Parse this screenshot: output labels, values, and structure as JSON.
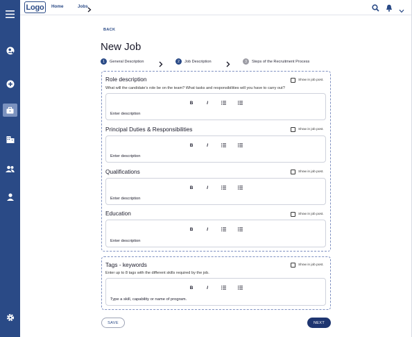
{
  "colors": {
    "brand": "#2a4a86",
    "brand_dark": "#1e3570",
    "dash_border": "#7d8fc0",
    "step_inactive": "#9c9ca4"
  },
  "topbar": {
    "logo": "Logo",
    "breadcrumb": [
      {
        "label": "Home"
      },
      {
        "label": "Jobs"
      }
    ],
    "icons": [
      "search-icon",
      "bell-icon",
      "chevron-down-icon"
    ]
  },
  "sidebar": {
    "items": [
      {
        "name": "menu-icon"
      },
      {
        "name": "user-settings-icon"
      },
      {
        "name": "add-circle-icon"
      },
      {
        "name": "briefcase-icon",
        "active": true
      },
      {
        "name": "building-icon"
      },
      {
        "name": "people-icon"
      },
      {
        "name": "person-icon"
      },
      {
        "name": "gear-icon"
      }
    ]
  },
  "page": {
    "back": "BACK",
    "title": "New Job"
  },
  "steps": [
    {
      "number": "1",
      "label": "General Description",
      "active": true
    },
    {
      "number": "2",
      "label": "Job Description",
      "active": true
    },
    {
      "number": "3",
      "label": "Steps of the Recruitment Process",
      "active": false
    }
  ],
  "sections": [
    {
      "title": "Role description",
      "show_label": "Show in job post.",
      "help": "What will the candidate's role be on the team? What tasks and responsibilities will you have to carry out?",
      "placeholder": "Enter description"
    },
    {
      "title": "Principal Duties & Responsibilities",
      "show_label": "Show in job post.",
      "placeholder": "Enter description"
    },
    {
      "title": "Qualifications",
      "show_label": "Show in job post.",
      "placeholder": "Enter description"
    },
    {
      "title": "Education",
      "show_label": "Show in job post.",
      "placeholder": "Enter description"
    }
  ],
  "tags": {
    "title": "Tags - keywords",
    "show_label": "Show in job post.",
    "help": "Enter up to 8 tags with the different skills required by the job.",
    "placeholder": "Type a skill, capability or name of program."
  },
  "toolbar": {
    "bold": "B",
    "italic": "I"
  },
  "buttons": {
    "save": "SAVE",
    "next": "NEXT"
  }
}
